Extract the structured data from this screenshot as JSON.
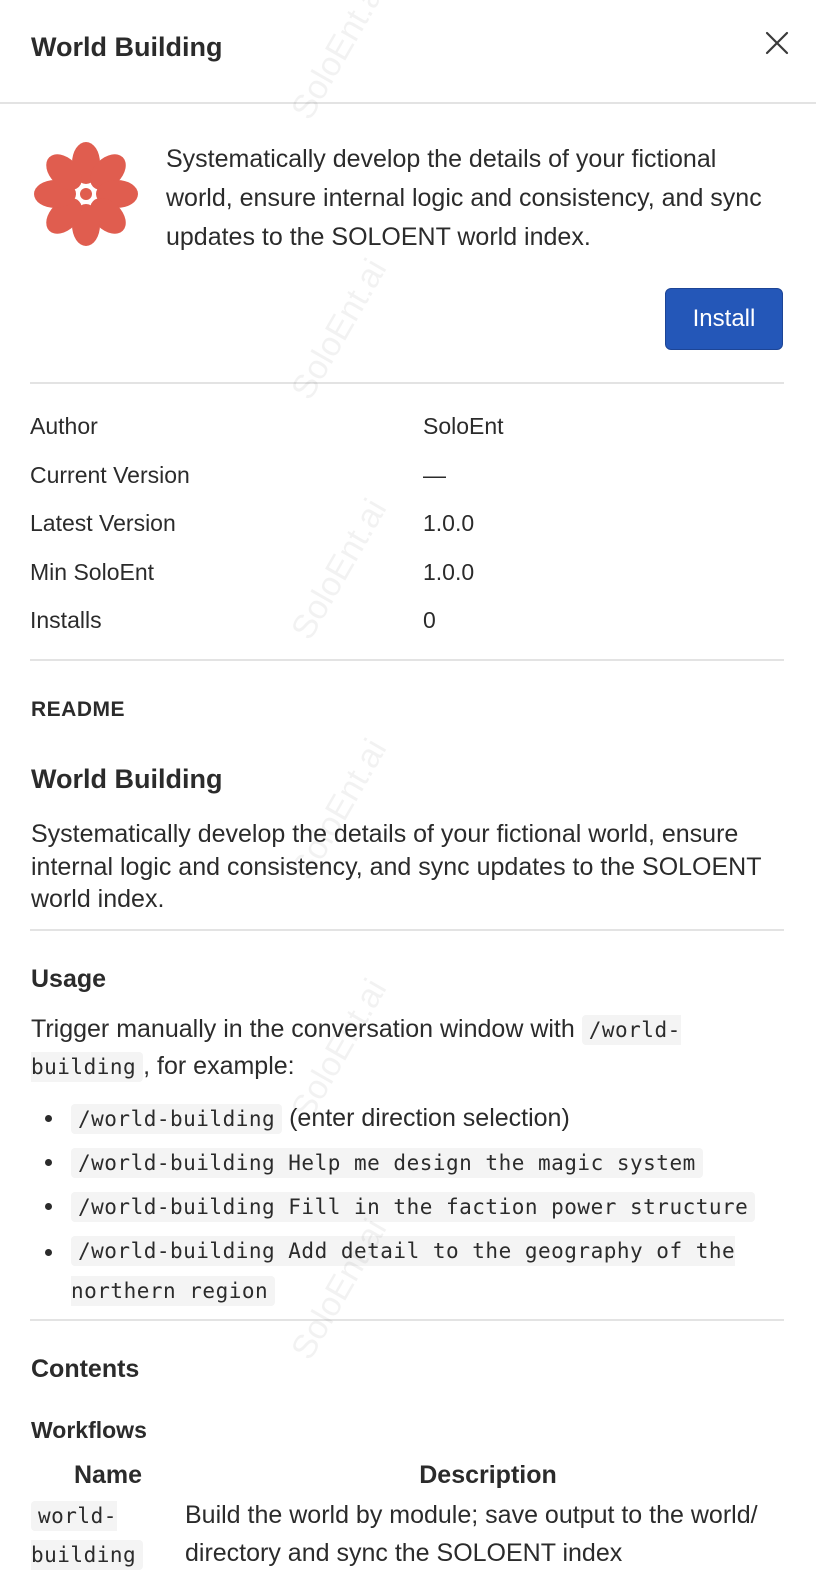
{
  "header": {
    "title": "World Building"
  },
  "intro": {
    "description": "Systematically develop the details of your fictional world, ensure internal logic and consistency, and sync updates to the SOLOENT world index.",
    "install_label": "Install"
  },
  "meta": [
    {
      "label": "Author",
      "value": "SoloEnt"
    },
    {
      "label": "Current Version",
      "value": "—"
    },
    {
      "label": "Latest Version",
      "value": "1.0.0"
    },
    {
      "label": "Min SoloEnt",
      "value": "1.0.0"
    },
    {
      "label": "Installs",
      "value": "0"
    }
  ],
  "readme": {
    "label": "README",
    "title": "World Building",
    "description": "Systematically develop the details of your fictional world, ensure internal logic and consistency, and sync updates to the SOLOENT world index.",
    "usage": {
      "title": "Usage",
      "intro_before": "Trigger manually in the conversation window with",
      "intro_code": "/world-building",
      "intro_after": ", for example:",
      "items": [
        {
          "code": "/world-building",
          "text": " (enter direction selection)"
        },
        {
          "code": "/world-building Help me design the magic system",
          "text": ""
        },
        {
          "code": "/world-building Fill in the faction power structure",
          "text": ""
        },
        {
          "code": "/world-building Add detail to the geography of the northern region",
          "text": ""
        }
      ]
    },
    "contents": {
      "title": "Contents",
      "workflows": {
        "title": "Workflows",
        "headers": [
          "Name",
          "Description"
        ],
        "rows": [
          {
            "name": "world-building",
            "description": "Build the world by module; save output to the world/ directory and sync the SOLOENT index"
          }
        ]
      }
    }
  },
  "colors": {
    "accent": "#2457b8",
    "logo": "#e05d4f"
  },
  "watermark": "SoloEnt.ai"
}
